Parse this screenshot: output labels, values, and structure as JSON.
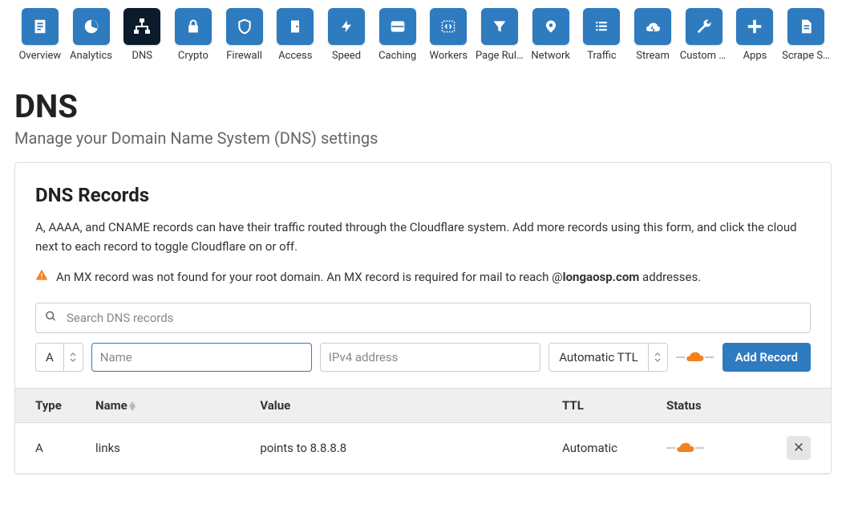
{
  "nav": [
    {
      "label": "Overview",
      "icon": "file"
    },
    {
      "label": "Analytics",
      "icon": "pie"
    },
    {
      "label": "DNS",
      "icon": "network",
      "active": true
    },
    {
      "label": "Crypto",
      "icon": "lock"
    },
    {
      "label": "Firewall",
      "icon": "shield"
    },
    {
      "label": "Access",
      "icon": "door"
    },
    {
      "label": "Speed",
      "icon": "bolt"
    },
    {
      "label": "Caching",
      "icon": "drive"
    },
    {
      "label": "Workers",
      "icon": "code"
    },
    {
      "label": "Page Rules",
      "icon": "funnel"
    },
    {
      "label": "Network",
      "icon": "pin"
    },
    {
      "label": "Traffic",
      "icon": "list"
    },
    {
      "label": "Stream",
      "icon": "cloud"
    },
    {
      "label": "Custom P...",
      "icon": "wrench"
    },
    {
      "label": "Apps",
      "icon": "plus"
    },
    {
      "label": "Scrape Sh...",
      "icon": "doc"
    }
  ],
  "page": {
    "title": "DNS",
    "subtitle": "Manage your Domain Name System (DNS) settings"
  },
  "records_card": {
    "heading": "DNS Records",
    "description": "A, AAAA, and CNAME records can have their traffic routed through the Cloudflare system. Add more records using this form, and click the cloud next to each record to toggle Cloudflare on or off.",
    "warning_prefix": "An MX record was not found for your root domain. An MX record is required for mail to reach @",
    "warning_domain": "longaosp.com",
    "warning_suffix": " addresses."
  },
  "search_placeholder": "Search DNS records",
  "form": {
    "type": "A",
    "name_placeholder": "Name",
    "ip_placeholder": "IPv4 address",
    "ttl": "Automatic TTL",
    "add_button": "Add Record"
  },
  "table": {
    "cols": {
      "type": "Type",
      "name": "Name",
      "value": "Value",
      "ttl": "TTL",
      "status": "Status"
    },
    "rows": [
      {
        "type": "A",
        "name": "links",
        "value": "points to 8.8.8.8",
        "ttl": "Automatic"
      }
    ]
  }
}
